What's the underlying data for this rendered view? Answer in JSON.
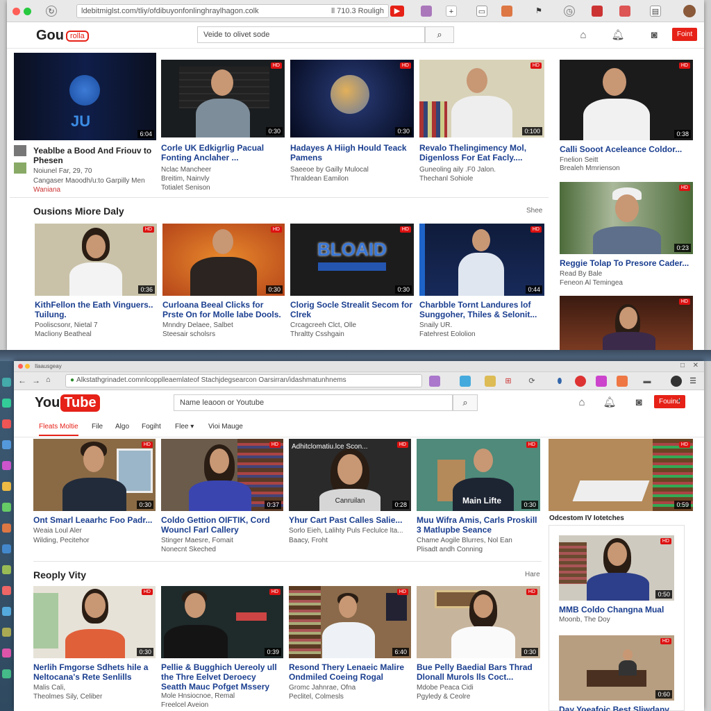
{
  "top": {
    "url": "ldebitmiglst.com/tliy/ofdibuyonfonlinghraylhagon.colk",
    "url_right": "ll 710.3 Rouligh",
    "logo_text": "Gou",
    "logo_pill": "rolla",
    "search_placeholder": "Veide to olivet sode",
    "signin": "Foint",
    "videos": [
      {
        "title": "Yeablbe a Bood And Friouv to Phesen",
        "meta1": "Noiunel Far, 29, 70",
        "meta2": "Cangaser Maoodh/u:to Garpilly Men",
        "meta3": "Waniana",
        "dur": "6:04"
      },
      {
        "title": "Corle UK Edkigrlig Pacual Fonting Anclaher ...",
        "meta1": "Nclac Mancheer",
        "meta2": "Breitim, Nainvly",
        "meta3": "Totialet Senison",
        "dur": "0:30"
      },
      {
        "title": "Hadayes A Hiigh Hould Teack Pamens",
        "meta1": "Saeeoe by Gailly Mulocal",
        "meta2": "Thraldean Eamilon",
        "meta3": "",
        "dur": "0:30"
      },
      {
        "title": "Revalo Thelingimency Mol, Digenloss For Eat Facly....",
        "meta1": "Guneoling aily .F0 Jalon.",
        "meta2": "Thechanl Sohiole",
        "meta3": "",
        "dur": "0:100"
      },
      {
        "title": "Calli Sooot Aceleance Coldor...",
        "meta1": "Fnelion Seitt",
        "meta2": "Brealeh Mmrienson",
        "meta3": "",
        "dur": "0:38"
      }
    ],
    "section": "Ousions Miore Daly",
    "section_right": "Shee",
    "videos2": [
      {
        "title": "KithFellon the Eath Vinguers.. Tuilung.",
        "meta1": "Pooliscsonr, Nietal 7",
        "meta2": "Macliony Beatheal",
        "dur": "0:36"
      },
      {
        "title": "Curloana Beeal Clicks for Prste On for Molle labe Dools.",
        "meta1": "Mnndry Delaee, Salbet",
        "meta2": "Steesair scholsrs",
        "dur": "0:30"
      },
      {
        "title": "Clorig Socle Strealit Secom for Clrek",
        "meta1": "Crcagcreeh Clct, Olle",
        "meta2": "Thraltty Csshgain",
        "dur": "0:30",
        "art": "BLOAID"
      },
      {
        "title": "Charbble Tornt Landures lof Sunggoher, Thiles & Selonit...",
        "meta1": "Snaily UR.",
        "meta2": "Fatehrest Eololion",
        "dur": "0:44"
      }
    ],
    "side": [
      {
        "title": "Reggie Tolap To Presore Cader...",
        "meta1": "Read By Bale",
        "meta2": "Feneon Al Temingea",
        "dur": "0:23"
      }
    ]
  },
  "bottom": {
    "tab_label": "Ilaausgeay",
    "url": "Alkstathgrinadet.comnlcopplleaemlateof Stachjdegsearcon Oarsirran/idashmatunhnems",
    "logo_you": "You",
    "logo_tube": "Tube",
    "search_placeholder": "Name leaoon or Youtube",
    "signin": "Fouind",
    "subnav": [
      "Fleats Moltie",
      "File",
      "Algo",
      "Fogiht",
      "Flee ▾",
      "Vioi Mauge"
    ],
    "row1": [
      {
        "title": "Ont Smarl Leaarhc Foo Padr...",
        "meta1": "Weaia Loul Aler",
        "meta2": "Wilding, Pecitehor",
        "dur": "0:30"
      },
      {
        "title": "Coldo Gettion OIFTIK, Cord Wouncl Farl Callery",
        "meta1": "Stinger Maesre, Fomait",
        "meta2": "Nonecnt Skeched",
        "dur": "0:37"
      },
      {
        "title": "Yhur Cart Past Calles Salie...",
        "meta1": "Sorlo Eieh, Lalihty Puls Feclulce lta...",
        "meta2": "Baacy, Froht",
        "dur": "0:28",
        "overlay_top": "Adhitclomatiu.lce Scon...",
        "overlay_bottom": "Canruilan"
      },
      {
        "title": "Muu Wifra Amis, Carls Proskill 3 Matlupbe Seance",
        "meta1": "Chame Aogile Blurres, Nol Ean",
        "meta2": "Plisadt andh Conning",
        "dur": "0:30",
        "overlay_bottom": "Main Lifte"
      },
      {
        "title": "",
        "meta1": "",
        "meta2": "",
        "dur": "0:59"
      }
    ],
    "side_heading": "Odcestom IV Iotetches",
    "section": "Reoply Vity",
    "section_right": "Hare",
    "row2": [
      {
        "title": "Nerlih Fmgorse Sdhets hile a Neltocana's Rete Senlills",
        "meta1": "Malis Cali,",
        "meta2": "Theolmes Sily, Celiber",
        "dur": "0:30"
      },
      {
        "title": "Pellie & Bugghich Uereoly ull the Thre Eelvet Deroecy Seatth Mauc Pofget Mssery",
        "meta1": "Mole Hnsiocnoe, Remal",
        "meta2": "Freelcel Aveion",
        "dur": "0:39"
      },
      {
        "title": "Resond Thery Lenaeic Malire Ondmiled Coeing Rogal",
        "meta1": "Gromc Jahnrae, Ofna",
        "meta2": "Peclitel, Colmesls",
        "dur": "6:40"
      },
      {
        "title": "Bue Pelly Baedial Bars Thrad Dlonall Murols lls Coct...",
        "meta1": "Mdobe Peaca Cidi",
        "meta2": "Pgyledy & Ceolre",
        "dur": "0:30"
      }
    ],
    "side": [
      {
        "title": "MMB Coldo Changna Mual",
        "meta1": "Moonb, The Doy",
        "dur": "0:50"
      },
      {
        "title": "Day Yoeafoic Best Sliwdanv",
        "meta1": "",
        "dur": "0:60"
      }
    ]
  },
  "colors": {
    "brand_red": "#e62117",
    "link_blue": "#1a3e8f"
  }
}
